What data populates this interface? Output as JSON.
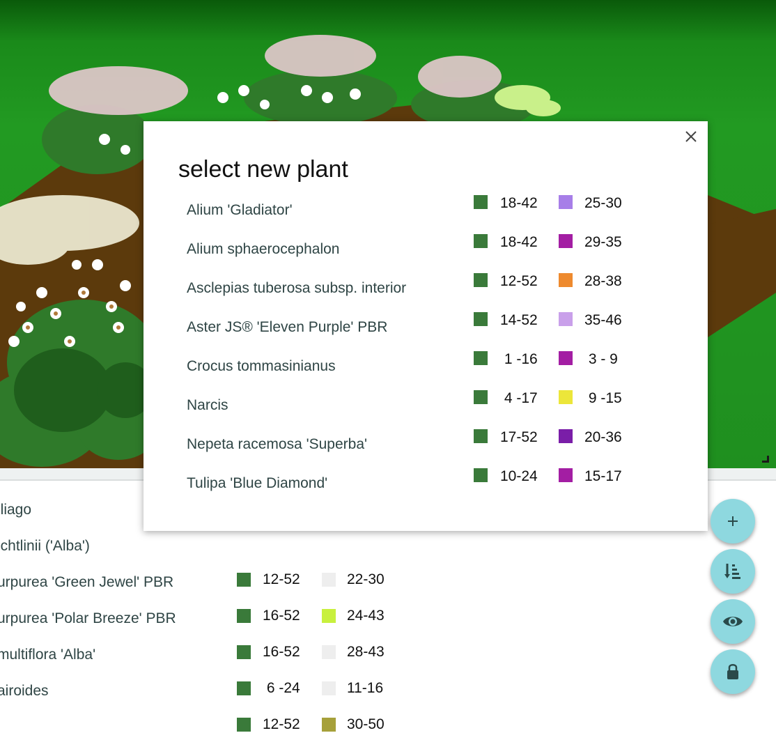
{
  "dialog": {
    "title": "select new plant",
    "plants": [
      {
        "name": "Alium 'Gladiator'",
        "range1": "18-42",
        "color1": "#3a7a3a",
        "range2": "25-30",
        "color2": "#a77ee8"
      },
      {
        "name": "Alium sphaerocephalon",
        "range1": "18-42",
        "color1": "#3a7a3a",
        "range2": "29-35",
        "color2": "#a31ea3"
      },
      {
        "name": "Asclepias tuberosa subsp. interior",
        "range1": "12-52",
        "color1": "#3a7a3a",
        "range2": "28-38",
        "color2": "#ee8a2e"
      },
      {
        "name": "Aster JS® 'Eleven Purple' PBR",
        "range1": "14-52",
        "color1": "#3a7a3a",
        "range2": "35-46",
        "color2": "#c9a0ea"
      },
      {
        "name": "Crocus tommasinianus",
        "range1": " 1 -16",
        "color1": "#3a7a3a",
        "range2": " 3 - 9",
        "color2": "#a31ea3"
      },
      {
        "name": "Narcis",
        "range1": " 4 -17",
        "color1": "#3a7a3a",
        "range2": " 9 -15",
        "color2": "#ece63a"
      },
      {
        "name": "Nepeta racemosa 'Superba'",
        "range1": "17-52",
        "color1": "#3a7a3a",
        "range2": "20-36",
        "color2": "#7a1ea8"
      },
      {
        "name": "Tulipa 'Blue Diamond'",
        "range1": "10-24",
        "color1": "#3a7a3a",
        "range2": "15-17",
        "color2": "#a31ea3"
      }
    ]
  },
  "background_list": [
    {
      "name": "iliago",
      "range1": "",
      "color1": "",
      "range2": "",
      "color2": ""
    },
    {
      "name": "ichtlinii ('Alba')",
      "range1": "12-52",
      "color1": "#3a7a3a",
      "range2": "22-30",
      "color2": "#eeeeee"
    },
    {
      "name": "urpurea 'Green Jewel' PBR",
      "range1": "16-52",
      "color1": "#3a7a3a",
      "range2": "24-43",
      "color2": "#c8f03e"
    },
    {
      "name": "urpurea 'Polar Breeze' PBR",
      "range1": "16-52",
      "color1": "#3a7a3a",
      "range2": "28-43",
      "color2": "#eeeeee"
    },
    {
      "name": "multiflora 'Alba'",
      "range1": " 6 -24",
      "color1": "#3a7a3a",
      "range2": "11-16",
      "color2": "#eeeeee"
    },
    {
      "name": "airoides",
      "range1": "12-52",
      "color1": "#3a7a3a",
      "range2": "30-50",
      "color2": "#a6a03a"
    }
  ],
  "fabs": [
    {
      "icon": "plus-icon"
    },
    {
      "icon": "sort-icon"
    },
    {
      "icon": "eye-icon"
    },
    {
      "icon": "lock-icon"
    }
  ],
  "colors": {
    "fab": "#8ed8df",
    "lawn": "#229a22",
    "soil": "#5c3a0c"
  }
}
